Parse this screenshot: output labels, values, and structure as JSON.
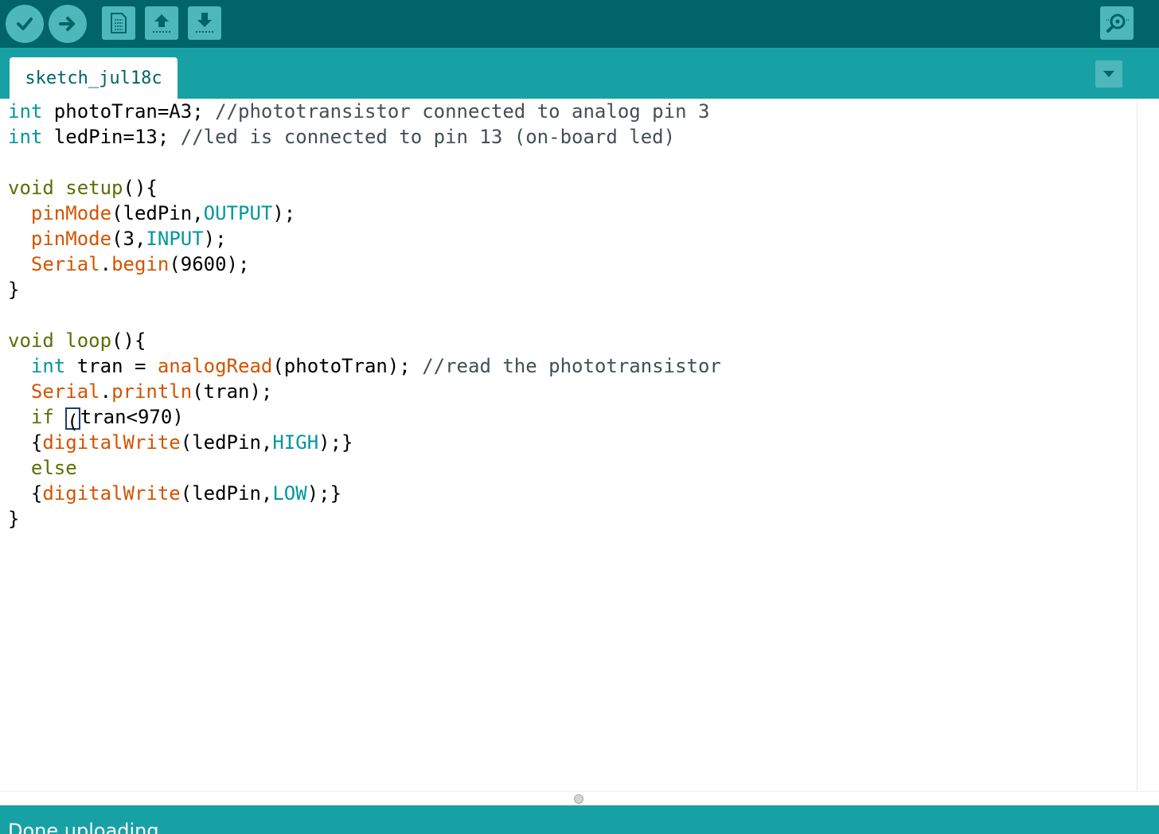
{
  "toolbar": {
    "buttons": [
      {
        "id": "verify",
        "icon": "check-icon"
      },
      {
        "id": "upload",
        "icon": "arrow-right-icon"
      },
      {
        "id": "new",
        "icon": "new-file-icon"
      },
      {
        "id": "open",
        "icon": "arrow-up-icon"
      },
      {
        "id": "save",
        "icon": "arrow-down-icon"
      },
      {
        "id": "serial-monitor",
        "icon": "magnifier-icon"
      }
    ]
  },
  "tabs": [
    {
      "label": "sketch_jul18c",
      "active": true
    }
  ],
  "editor": {
    "lines": [
      "int photoTran=A3; //phototransistor connected to analog pin 3",
      "int ledPin=13; //led is connected to pin 13 (on-board led)",
      "",
      "void setup(){",
      "  pinMode(ledPin,OUTPUT);",
      "  pinMode(3,INPUT);",
      "  Serial.begin(9600);",
      "}",
      "",
      "void loop(){",
      "  int tran = analogRead(photoTran); //read the phototransistor",
      "  Serial.println(tran);",
      "  if (tran<970)",
      "  {digitalWrite(ledPin,HIGH);}",
      "  else",
      "  {digitalWrite(ledPin,LOW);}",
      "}"
    ]
  },
  "status": {
    "message": "Done uploading."
  },
  "colors": {
    "toolbar_bg": "#006468",
    "tabbar_bg": "#17a1a5",
    "button_bg": "#4db7bb",
    "keyword": "#00979c",
    "control": "#5e6d03",
    "function": "#d35400"
  }
}
